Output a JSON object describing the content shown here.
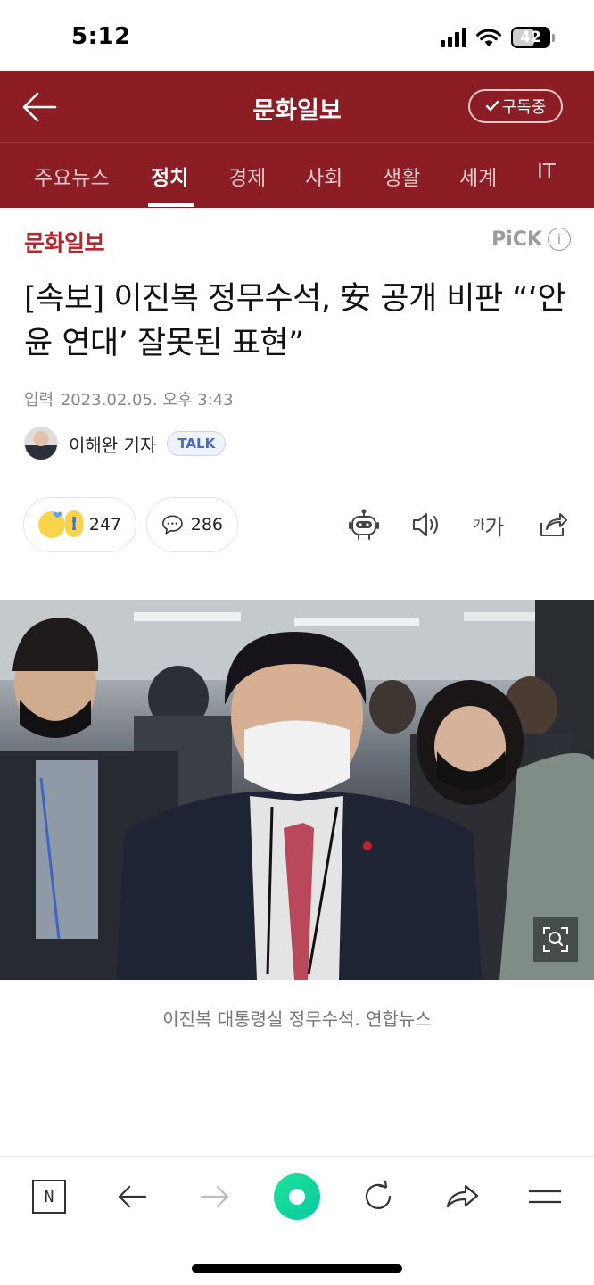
{
  "status_bar": {
    "time": "5:12",
    "battery": "42"
  },
  "header": {
    "title": "문화일보",
    "subscribe_label": "구독중"
  },
  "tabs": [
    {
      "label": "주요뉴스"
    },
    {
      "label": "정치"
    },
    {
      "label": "경제"
    },
    {
      "label": "사회"
    },
    {
      "label": "생활"
    },
    {
      "label": "세계"
    },
    {
      "label": "IT"
    }
  ],
  "article": {
    "press_name": "문화일보",
    "pick_label": "PiCK",
    "headline": "[속보] 이진복 정무수석, 安 공개 비판 “‘안윤 연대’ 잘못된 표현”",
    "published_label": "입력",
    "published_time": "2023.02.05. 오후 3:43",
    "reporter": "이해완 기자",
    "talk_label": "TALK",
    "reaction_count": "247",
    "comment_count": "286",
    "font_size_small": "가",
    "font_size_large": "가",
    "photo_caption": "이진복 대통령실 정무수석. 연합뉴스"
  },
  "toolbar": {
    "n_logo": "N"
  }
}
